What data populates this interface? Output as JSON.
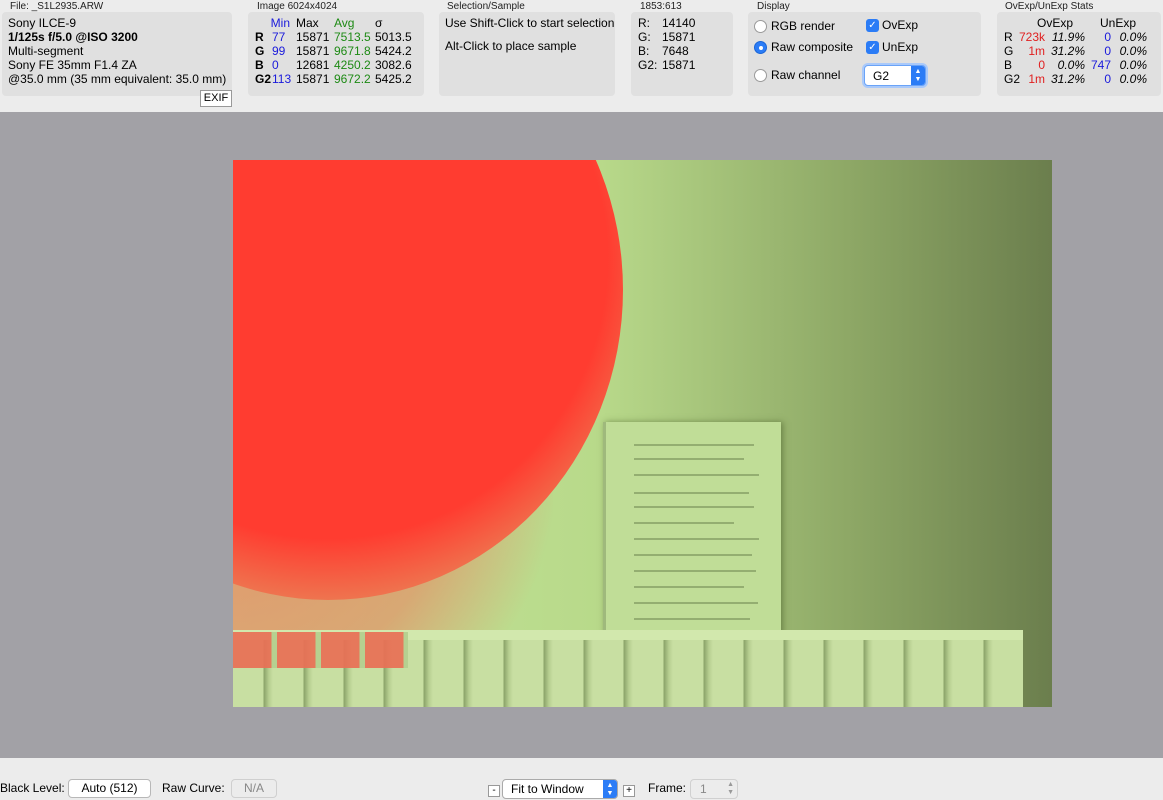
{
  "file_group": {
    "title": "File: _S1L2935.ARW",
    "lines": [
      "Sony ILCE-9",
      "1/125s f/5.0 @ISO 3200",
      "Multi-segment",
      "Sony FE 35mm F1.4 ZA",
      "@35.0 mm (35 mm equivalent: 35.0 mm)"
    ],
    "exif_button": "EXIF"
  },
  "image_group": {
    "title": "Image 6024x4024",
    "headers": [
      "Min",
      "Max",
      "Avg",
      "σ"
    ],
    "rows": [
      {
        "ch": "R",
        "min": "77",
        "max": "15871",
        "avg": "7513.5",
        "sd": "5013.5"
      },
      {
        "ch": "G",
        "min": "99",
        "max": "15871",
        "avg": "9671.8",
        "sd": "5424.2"
      },
      {
        "ch": "B",
        "min": "0",
        "max": "12681",
        "avg": "4250.2",
        "sd": "3082.6"
      },
      {
        "ch": "G2",
        "min": "113",
        "max": "15871",
        "avg": "9672.2",
        "sd": "5425.2"
      }
    ]
  },
  "selection_group": {
    "title": "Selection/Sample",
    "line1": "Use Shift-Click to start selection",
    "line2": "Alt-Click to place sample"
  },
  "pixel_group": {
    "title": "1853:613",
    "rows": [
      {
        "label": "R:",
        "value": "14140"
      },
      {
        "label": "G:",
        "value": "15871"
      },
      {
        "label": "B:",
        "value": "7648"
      },
      {
        "label": "G2:",
        "value": "15871"
      }
    ]
  },
  "display_group": {
    "title": "Display",
    "radios": [
      {
        "label": "RGB render",
        "selected": false
      },
      {
        "label": "Raw composite",
        "selected": true
      },
      {
        "label": "Raw channel",
        "selected": false
      }
    ],
    "checks": [
      {
        "label": "OvExp",
        "checked": true
      },
      {
        "label": "UnExp",
        "checked": true
      }
    ],
    "channel_select": "G2"
  },
  "stats_group": {
    "title": "OvExp/UnExp Stats",
    "headers": [
      "OvExp",
      "UnExp"
    ],
    "rows": [
      {
        "ch": "R",
        "ov": "723k",
        "ovp": "11.9%",
        "un": "0",
        "unp": "0.0%"
      },
      {
        "ch": "G",
        "ov": "1m",
        "ovp": "31.2%",
        "un": "0",
        "unp": "0.0%"
      },
      {
        "ch": "B",
        "ov": "0",
        "ovp": "0.0%",
        "un": "747",
        "unp": "0.0%"
      },
      {
        "ch": "G2",
        "ov": "1m",
        "ovp": "31.2%",
        "un": "0",
        "unp": "0.0%"
      }
    ]
  },
  "bottom_bar": {
    "black_level_label": "Black Level:",
    "black_level_value": "Auto (512)",
    "raw_curve_label": "Raw Curve:",
    "raw_curve_value": "N/A",
    "zoom_minus": "-",
    "zoom_value": "Fit to Window",
    "zoom_plus": "+",
    "frame_label": "Frame:",
    "frame_value": "1"
  },
  "colors": {
    "accent": "#2b7cf6",
    "ovexp": "#ff3c30",
    "viewer_bg": "#a2a1a6",
    "min_col": "#1a1adb",
    "avg_col": "#1d8a14"
  },
  "icons": [
    "checkmark-icon",
    "chevron-updown-icon"
  ]
}
